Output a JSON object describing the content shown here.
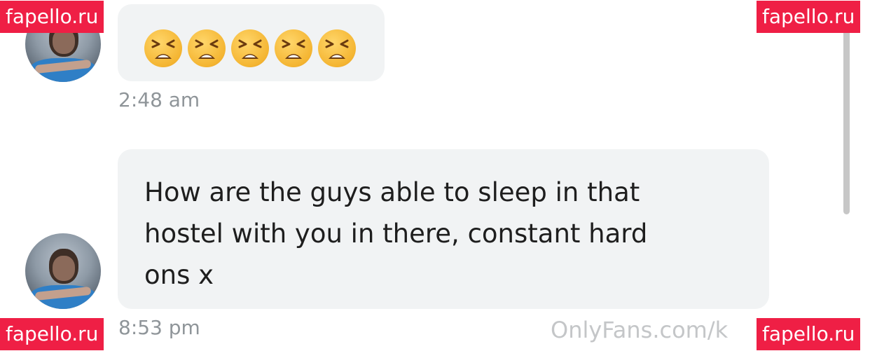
{
  "messages": [
    {
      "type": "emoji",
      "emojis": [
        "😫",
        "😫",
        "😫",
        "😫",
        "😫"
      ],
      "emoji_name": "tired-face-icon",
      "time": "2:48 am"
    },
    {
      "type": "text",
      "text": "How are the guys able to sleep in that\nhostel with you in there, constant hard\nons x",
      "time": "8:53 pm"
    }
  ],
  "watermarks": {
    "top_left": "fapello.ru",
    "top_right": "fapello.ru",
    "bottom_left": "fapello.ru",
    "bottom_right": "fapello.ru"
  },
  "footer_url": "OnlyFans.com/k",
  "colors": {
    "bubble_bg": "#f1f3f4",
    "timestamp": "#8f9599",
    "watermark_bg": "#ef1f45",
    "text": "#1e1e1e"
  }
}
